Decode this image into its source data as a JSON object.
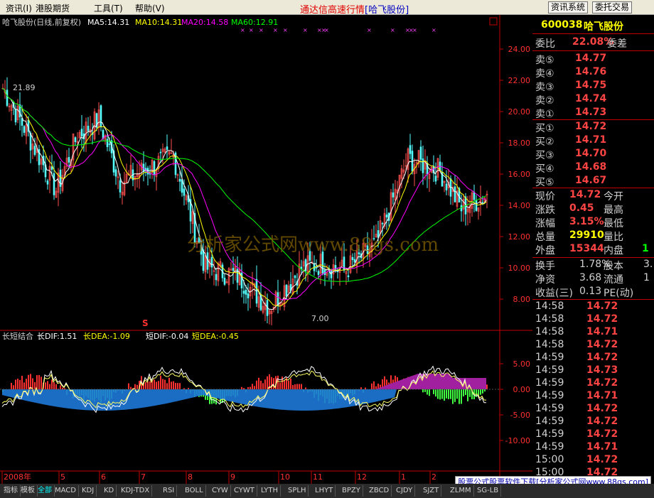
{
  "menu": {
    "items": [
      {
        "label": "资讯",
        "key": "I",
        "left": 8
      },
      {
        "label": "港股期货",
        "key": "",
        "left": 50
      },
      {
        "label": "工具",
        "key": "T",
        "left": 132
      },
      {
        "label": "帮助",
        "key": "V",
        "left": 190
      }
    ],
    "title": "通达信高速行情",
    "title_stock": "[哈飞股份]",
    "btn_news": "资讯系统",
    "btn_order": "委托交易"
  },
  "chart": {
    "header_name": "哈飞股份(日线,前复权)",
    "ma5": "MA5:14.31",
    "ma10": "MA10:14.31",
    "ma20": "MA20:14.58",
    "ma60": "MA60:12.91",
    "high_label": "21.89",
    "low_label": "7.00",
    "y_ticks": [
      "24.00",
      "22.00",
      "20.00",
      "18.00",
      "16.00",
      "14.00",
      "12.00",
      "10.00",
      "8.00"
    ],
    "watermark": "分析家公式网www.88gs.com",
    "ind_title": "长短结合",
    "long_dif": "长DIF:1.51",
    "long_dea": "长DEA:-1.09",
    "short_dif": "短DIF:-0.04",
    "short_dea": "短DEA:-0.45",
    "ind_ticks": [
      "5.00",
      "0.00",
      "-5.00",
      "-10.00"
    ],
    "signal_label": "S",
    "x_labels": [
      "2008年",
      "5",
      "6",
      "7",
      "8",
      "9",
      "10",
      "11",
      "12",
      "1",
      "2"
    ],
    "colors": {
      "ma5": "#ffffff",
      "ma10": "#ffff00",
      "ma20": "#ff00ff",
      "ma60": "#00ff00",
      "up": "#ff5050",
      "down": "#54ffff"
    }
  },
  "quote": {
    "code": "600038",
    "name": "哈飞股份",
    "weibi_label": "委比",
    "weibi_val": "22.08%",
    "weicha_label": "委差",
    "asks": [
      {
        "label": "卖⑤",
        "price": "14.77"
      },
      {
        "label": "卖④",
        "price": "14.76"
      },
      {
        "label": "卖③",
        "price": "14.75"
      },
      {
        "label": "卖②",
        "price": "14.74"
      },
      {
        "label": "卖①",
        "price": "14.73"
      }
    ],
    "bids": [
      {
        "label": "买①",
        "price": "14.72"
      },
      {
        "label": "买②",
        "price": "14.71"
      },
      {
        "label": "买③",
        "price": "14.70"
      },
      {
        "label": "买④",
        "price": "14.68"
      },
      {
        "label": "买⑤",
        "price": "14.67"
      }
    ],
    "stats": [
      {
        "l1": "现价",
        "v1": "14.72",
        "c1": "r",
        "l2": "今开"
      },
      {
        "l1": "涨跌",
        "v1": "0.45",
        "c1": "r",
        "l2": "最高"
      },
      {
        "l1": "涨幅",
        "v1": "3.15%",
        "c1": "r",
        "l2": "最低"
      },
      {
        "l1": "总量",
        "v1": "29910",
        "c1": "y",
        "l2": "量比"
      },
      {
        "l1": "外盘",
        "v1": "15344",
        "c1": "r",
        "l2": "内盘",
        "v2": "1",
        "c2": "g"
      }
    ],
    "stats2": [
      {
        "l1": "换手",
        "v1": "1.78%",
        "l2": "股本",
        "v2": "3."
      },
      {
        "l1": "净资",
        "v1": "3.68",
        "l2": "流通",
        "v2": "1"
      },
      {
        "l1": "收益(三)",
        "v1": "0.13",
        "l2": "PE(动)"
      }
    ],
    "ticks": [
      {
        "time": "14:58",
        "price": "14.72"
      },
      {
        "time": "14:58",
        "price": "14.72"
      },
      {
        "time": "14:58",
        "price": "14.71"
      },
      {
        "time": "14:58",
        "price": "14.72"
      },
      {
        "time": "14:59",
        "price": "14.72"
      },
      {
        "time": "14:59",
        "price": "14.73"
      },
      {
        "time": "14:59",
        "price": "14.72"
      },
      {
        "time": "14:59",
        "price": "14.71"
      },
      {
        "time": "14:59",
        "price": "14.72"
      },
      {
        "time": "14:59",
        "price": "14.72"
      },
      {
        "time": "14:59",
        "price": "14.72"
      },
      {
        "time": "14:59",
        "price": "14.71"
      },
      {
        "time": "15:00",
        "price": "14.72"
      },
      {
        "time": "15:00",
        "price": "14.72"
      }
    ]
  },
  "tabs": [
    "指标",
    "模板",
    "全部",
    "MACD",
    "KDJ",
    "KD",
    "KDJ-TDX",
    "RSI",
    "BOLL",
    "CYW",
    "CYWT",
    "LYTH",
    "SPLH",
    "LHYT",
    "BPZY",
    "ZBCD",
    "CJDY",
    "SJZT",
    "ZLMM",
    "SG-LB"
  ],
  "footer": "股票公式股票软件下载[分析家公式网www.88gs.com]"
}
